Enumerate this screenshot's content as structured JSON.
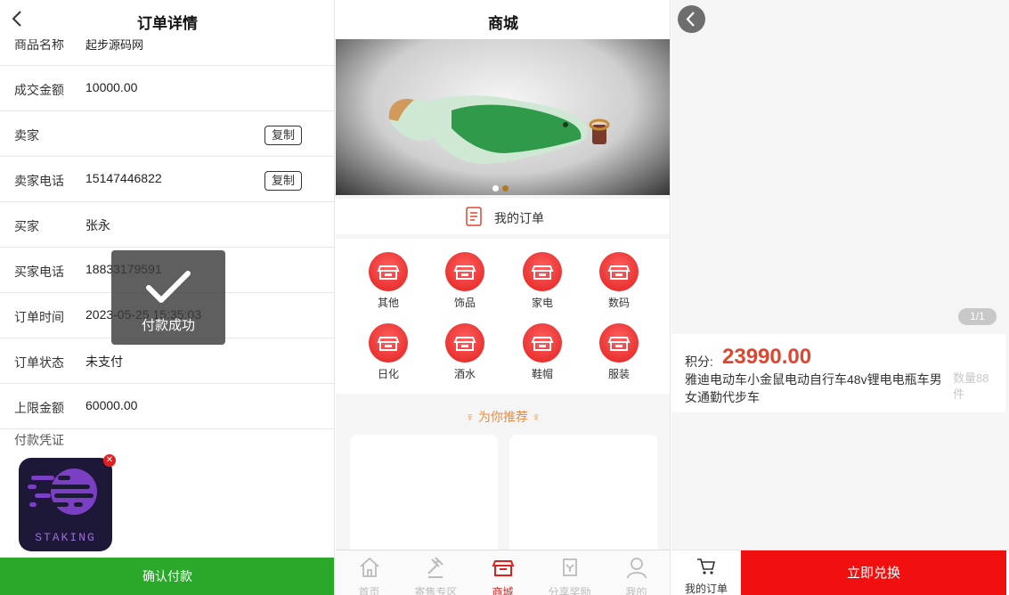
{
  "order": {
    "title": "订单详情",
    "rows": [
      {
        "label": "商品名称",
        "value": "起步源码网"
      },
      {
        "label": "成交金额",
        "value": "10000.00"
      },
      {
        "label": "卖家",
        "value": ""
      },
      {
        "label": "卖家电话",
        "value": "15147446822"
      },
      {
        "label": "买家",
        "value": "张永"
      },
      {
        "label": "买家电话",
        "value": "18833179591"
      },
      {
        "label": "订单时间",
        "value": "2023-05-25 15:35:03"
      },
      {
        "label": "订单状态",
        "value": "未支付"
      },
      {
        "label": "上限金额",
        "value": "60000.00"
      }
    ],
    "copy_label": "复制",
    "voucher_label": "付款凭证",
    "voucher_image_text": "STAKING",
    "confirm_label": "确认付款",
    "toast": "付款成功"
  },
  "mall": {
    "title": "商城",
    "my_orders": "我的订单",
    "categories": [
      "其他",
      "饰品",
      "家电",
      "数码",
      "日化",
      "酒水",
      "鞋帽",
      "服装"
    ],
    "recommend": "为你推荐",
    "tabs": [
      {
        "label": "首页",
        "icon": "home-icon"
      },
      {
        "label": "寄售专区",
        "icon": "auction-icon"
      },
      {
        "label": "商城",
        "icon": "shop-icon"
      },
      {
        "label": "分享奖励",
        "icon": "share-icon"
      },
      {
        "label": "我的",
        "icon": "user-icon"
      }
    ],
    "active_tab": "商城",
    "accent": "#e0201e"
  },
  "product": {
    "pager": "1/1",
    "points_label": "积分:",
    "points_value": "23990.00",
    "name": "雅迪电动车小金鼠电动自行车48v锂电电瓶车男女通勤代步车",
    "qty": "数量88件",
    "my_orders": "我的订单",
    "redeem": "立即兑换",
    "redeem_color": "#f01010"
  }
}
